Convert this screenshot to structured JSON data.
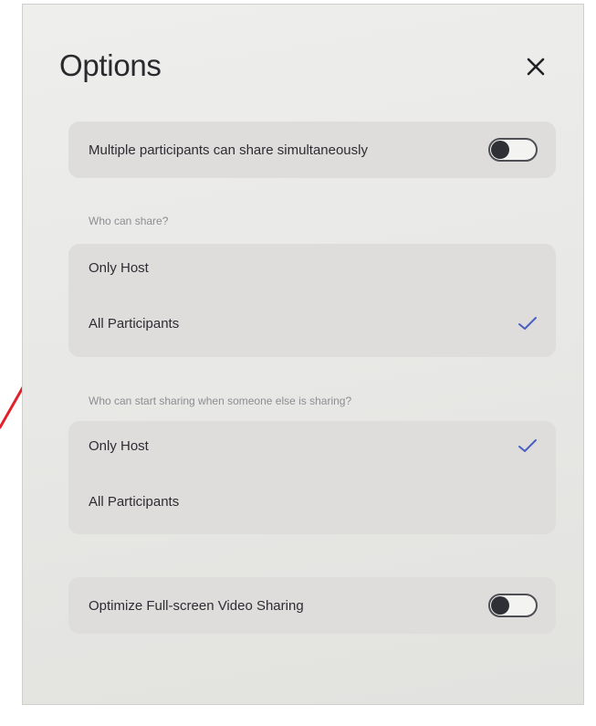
{
  "dialog": {
    "title": "Options",
    "close_icon": "close-icon"
  },
  "multiple_share": {
    "label": "Multiple participants can share simultaneously",
    "enabled": false
  },
  "who_can_share": {
    "label": "Who can share?",
    "options": [
      {
        "label": "Only Host",
        "selected": false
      },
      {
        "label": "All Participants",
        "selected": true
      }
    ]
  },
  "who_can_start": {
    "label": "Who can start sharing when someone else is sharing?",
    "options": [
      {
        "label": "Only Host",
        "selected": true
      },
      {
        "label": "All Participants",
        "selected": false
      }
    ]
  },
  "optimize_video": {
    "label": "Optimize Full-screen Video Sharing",
    "enabled": false
  },
  "colors": {
    "check": "#4a5fc4",
    "annotation": "#e0202a"
  }
}
